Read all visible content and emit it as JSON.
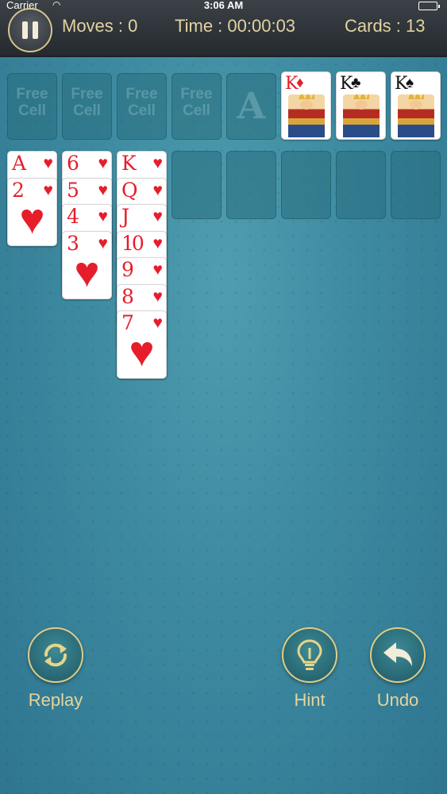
{
  "status_bar": {
    "carrier": "Carrier",
    "time": "3:06 AM"
  },
  "hud": {
    "moves": "Moves : 0",
    "time": "Time : 00:00:03",
    "cards": "Cards : 13"
  },
  "free_cells": [
    {
      "line1": "Free",
      "line2": "Cell"
    },
    {
      "line1": "Free",
      "line2": "Cell"
    },
    {
      "line1": "Free",
      "line2": "Cell"
    },
    {
      "line1": "Free",
      "line2": "Cell"
    }
  ],
  "foundations": {
    "empty_label": "A",
    "cards": [
      {
        "rank": "K",
        "suit": "♦",
        "color": "red"
      },
      {
        "rank": "K",
        "suit": "♣",
        "color": "black"
      },
      {
        "rank": "K",
        "suit": "♠",
        "color": "black"
      }
    ]
  },
  "tableau": {
    "column1": [
      {
        "rank": "A",
        "suit": "♥"
      },
      {
        "rank": "2",
        "suit": "♥"
      }
    ],
    "column2": [
      {
        "rank": "6",
        "suit": "♥"
      },
      {
        "rank": "5",
        "suit": "♥"
      },
      {
        "rank": "4",
        "suit": "♥"
      },
      {
        "rank": "3",
        "suit": "♥"
      }
    ],
    "column3": [
      {
        "rank": "K",
        "suit": "♥"
      },
      {
        "rank": "Q",
        "suit": "♥"
      },
      {
        "rank": "J",
        "suit": "♥"
      },
      {
        "rank": "10",
        "suit": "♥"
      },
      {
        "rank": "9",
        "suit": "♥"
      },
      {
        "rank": "8",
        "suit": "♥"
      },
      {
        "rank": "7",
        "suit": "♥"
      }
    ]
  },
  "controls": {
    "replay": "Replay",
    "hint": "Hint",
    "undo": "Undo"
  },
  "colors": {
    "accent_gold": "#e0cd86",
    "heart_red": "#e61d2b",
    "felt": "#3d8aa0"
  },
  "icons": {
    "pause": "pause-icon",
    "replay": "replay-icon",
    "hint": "lightbulb-icon",
    "undo": "undo-arrow-icon"
  }
}
